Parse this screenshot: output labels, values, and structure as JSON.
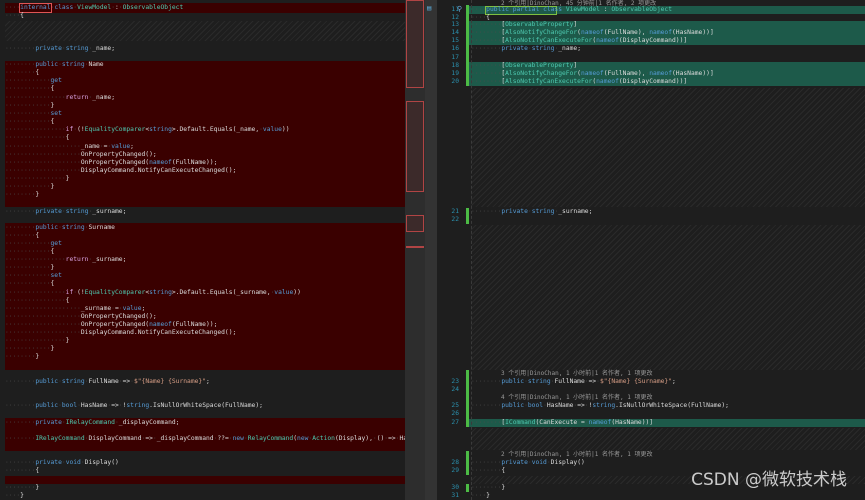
{
  "left": {
    "lines": [
      "    internal class ViewModel : ObservableObject",
      "    {",
      "        private string _name;",
      "        public string Name",
      "        {",
      "            get",
      "            {",
      "                return _name;",
      "            }",
      "            set",
      "            {",
      "                if (!EqualityComparer<string>.Default.Equals(_name, value))",
      "                {",
      "                    _name = value;",
      "                    OnPropertyChanged();",
      "                    OnPropertyChanged(nameof(FullName));",
      "                    DisplayCommand.NotifyCanExecuteChanged();",
      "                }",
      "            }",
      "        }",
      "        private string _surname;",
      "        public string Surname",
      "        {",
      "            get",
      "            {",
      "                return _surname;",
      "            }",
      "            set",
      "            {",
      "                if (!EqualityComparer<string>.Default.Equals(_surname, value))",
      "                {",
      "                    _surname = value;",
      "                    OnPropertyChanged();",
      "                    OnPropertyChanged(nameof(FullName));",
      "                    DisplayCommand.NotifyCanExecuteChanged();",
      "                }",
      "            }",
      "        }",
      "        public string FullName => $\"{Name} {Surname}\";",
      "        public bool HasName => !string.IsNullOrWhiteSpace(FullName);",
      "        private IRelayCommand _displayCommand;",
      "        IRelayCommand DisplayCommand => _displayCommand ??= new RelayCommand(new Action(Display), () => HasName);",
      "        private void Display()",
      "        {",
      "        }",
      "    }"
    ]
  },
  "right": {
    "codelens": [
      "2 个引用|DinoChan, 45 分钟前|1 名作者, 2 项更改",
      "3 个引用|DinoChan, 1 小时前|1 名作者, 1 项更改",
      "4 个引用|DinoChan, 1 小时前|1 名作者, 1 项更改",
      "2 个引用|DinoChan, 1 小时前|1 名作者, 1 项更改"
    ],
    "lines": [
      {
        "n": "11",
        "text": "    public partial class ViewModel : ObservableObject"
      },
      {
        "n": "12",
        "text": "    {"
      },
      {
        "n": "13",
        "text": "        [ObservableProperty]"
      },
      {
        "n": "14",
        "text": "        [AlsoNotifyChangeFor(nameof(FullName), nameof(HasName))]"
      },
      {
        "n": "15",
        "text": "        [AlsoNotifyCanExecuteFor(nameof(DisplayCommand))]"
      },
      {
        "n": "16",
        "text": "        private string _name;"
      },
      {
        "n": "17",
        "text": ""
      },
      {
        "n": "18",
        "text": "        [ObservableProperty]"
      },
      {
        "n": "19",
        "text": "        [AlsoNotifyChangeFor(nameof(FullName), nameof(HasName))]"
      },
      {
        "n": "20",
        "text": "        [AlsoNotifyCanExecuteFor(nameof(DisplayCommand))]"
      },
      {
        "n": "21",
        "text": "        private string _surname;"
      },
      {
        "n": "22",
        "text": ""
      },
      {
        "n": "23",
        "text": "        public string FullName => $\"{Name} {Surname}\";"
      },
      {
        "n": "24",
        "text": ""
      },
      {
        "n": "25",
        "text": "        public bool HasName => !string.IsNullOrWhiteSpace(FullName);"
      },
      {
        "n": "26",
        "text": ""
      },
      {
        "n": "27",
        "text": "        [ICommand(CanExecute = nameof(HasName))]"
      },
      {
        "n": "28",
        "text": "        private void Display()"
      },
      {
        "n": "29",
        "text": "        {"
      },
      {
        "n": "30",
        "text": "        }"
      },
      {
        "n": "31",
        "text": "    }"
      }
    ]
  },
  "watermark": "CSDN @微软技术栈",
  "colors": {
    "removed": "#3a0000",
    "added": "#1d5a4a",
    "change_bar": "#4cbb45",
    "keyword": "#569cd6",
    "type": "#4ec9b0"
  }
}
